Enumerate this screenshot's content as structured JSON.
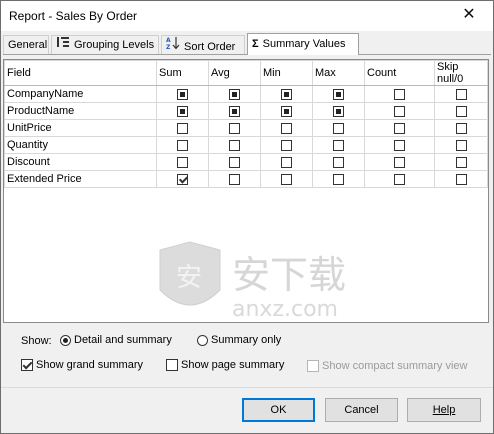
{
  "window": {
    "title": "Report - Sales By Order",
    "close_glyph": "✕"
  },
  "tabs": [
    {
      "label": "General",
      "icon": ""
    },
    {
      "label": "Grouping Levels",
      "icon": "grouping-icon"
    },
    {
      "label": "Sort Order",
      "icon": "sort-az-icon"
    },
    {
      "label": "Summary Values",
      "icon": "sigma-icon"
    }
  ],
  "active_tab": "Summary Values",
  "grid": {
    "columns": [
      "Field",
      "Sum",
      "Avg",
      "Min",
      "Max",
      "Count",
      "Skip null/0"
    ],
    "rows": [
      {
        "field": "CompanyName",
        "sum": "filled",
        "avg": "filled",
        "min": "filled",
        "max": "filled",
        "count": "unchecked",
        "skip": "unchecked"
      },
      {
        "field": "ProductName",
        "sum": "filled",
        "avg": "filled",
        "min": "filled",
        "max": "filled",
        "count": "unchecked",
        "skip": "unchecked"
      },
      {
        "field": "UnitPrice",
        "sum": "unchecked",
        "avg": "unchecked",
        "min": "unchecked",
        "max": "unchecked",
        "count": "unchecked",
        "skip": "unchecked"
      },
      {
        "field": "Quantity",
        "sum": "unchecked",
        "avg": "unchecked",
        "min": "unchecked",
        "max": "unchecked",
        "count": "unchecked",
        "skip": "unchecked"
      },
      {
        "field": "Discount",
        "sum": "unchecked",
        "avg": "unchecked",
        "min": "unchecked",
        "max": "unchecked",
        "count": "unchecked",
        "skip": "unchecked"
      },
      {
        "field": "Extended Price",
        "sum": "checked",
        "avg": "unchecked",
        "min": "unchecked",
        "max": "unchecked",
        "count": "unchecked",
        "skip": "unchecked"
      }
    ]
  },
  "show": {
    "label": "Show:",
    "option_detail": "Detail and summary",
    "option_summary": "Summary only",
    "selected": "Detail and summary"
  },
  "checkboxes": {
    "grand_summary": {
      "label": "Show grand summary",
      "checked": true
    },
    "page_summary": {
      "label": "Show page summary",
      "checked": false
    },
    "compact_summary": {
      "label": "Show compact summary view",
      "checked": false,
      "disabled": true
    }
  },
  "buttons": {
    "ok": "OK",
    "cancel": "Cancel",
    "help": "Help"
  },
  "watermark": {
    "text": "安下载",
    "subtext": "anxz.com"
  },
  "colors": {
    "accent": "#0078d7",
    "window_bg": "#f0f0f0"
  }
}
